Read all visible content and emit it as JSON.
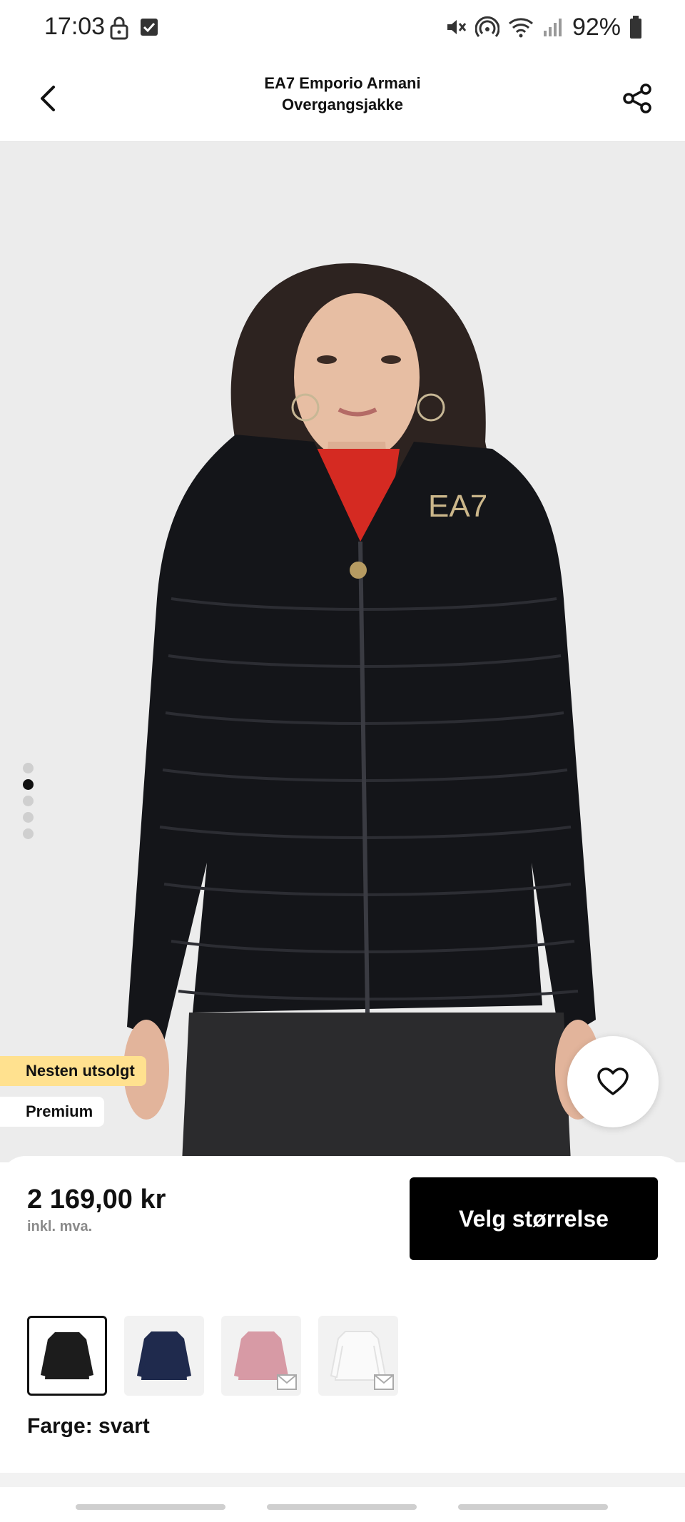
{
  "status_bar": {
    "time": "17:03",
    "battery": "92%"
  },
  "header": {
    "title_line1": "EA7 Emporio Armani",
    "title_line2": "Overgangsjakke"
  },
  "badges": {
    "almost_sold_out": "Nesten utsolgt",
    "premium": "Premium"
  },
  "carousel": {
    "total": 5,
    "active_index": 1
  },
  "product": {
    "price": "2 169,00 kr",
    "vat_note": "inkl. mva.",
    "select_size_label": "Velg størrelse",
    "color_label": "Farge: svart",
    "brand_logo_text": "EA7"
  },
  "swatches": [
    {
      "color": "black",
      "hex": "#1c1c1c",
      "selected": true
    },
    {
      "color": "navy",
      "hex": "#1f2a4d",
      "selected": false
    },
    {
      "color": "pink",
      "hex": "#d79aa5",
      "selected": false
    },
    {
      "color": "white",
      "hex": "#f3f3f3",
      "selected": false
    }
  ],
  "colors": {
    "accent_badge": "#ffe18f",
    "button_bg": "#000000",
    "image_bg": "#ededed"
  }
}
